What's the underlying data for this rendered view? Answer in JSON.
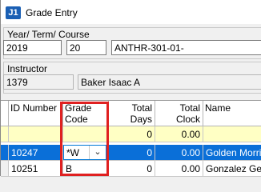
{
  "window": {
    "icon_text": "J1",
    "title": "Grade Entry"
  },
  "year_term_course": {
    "label": "Year/ Term/ Course",
    "year": "2019",
    "term": "20",
    "course": "ANTHR-301-01-"
  },
  "instructor": {
    "label": "Instructor",
    "id": "1379",
    "name": "Baker Isaac A"
  },
  "grid": {
    "columns": [
      {
        "label": "ID Number"
      },
      {
        "label": "Grade Code"
      },
      {
        "label": "Total Days Absent"
      },
      {
        "label": "Total Clock Hours"
      },
      {
        "label": "Name"
      }
    ],
    "filter_row": {
      "id": "",
      "grade": "",
      "days_absent": "0",
      "clock_hours": "0.00",
      "name": ""
    },
    "rows": [
      {
        "id": "10247",
        "grade": "*W",
        "days_absent": "0",
        "clock_hours": "0.00",
        "name": "Golden Morris",
        "selected": true
      },
      {
        "id": "10251",
        "grade": "B",
        "days_absent": "0",
        "clock_hours": "0.00",
        "name": "Gonzalez Georg"
      }
    ]
  },
  "colors": {
    "selection": "#0a6fd8",
    "filter_row": "#ffffc4",
    "highlight": "#e02020",
    "app_icon": "#1a5fb4"
  }
}
